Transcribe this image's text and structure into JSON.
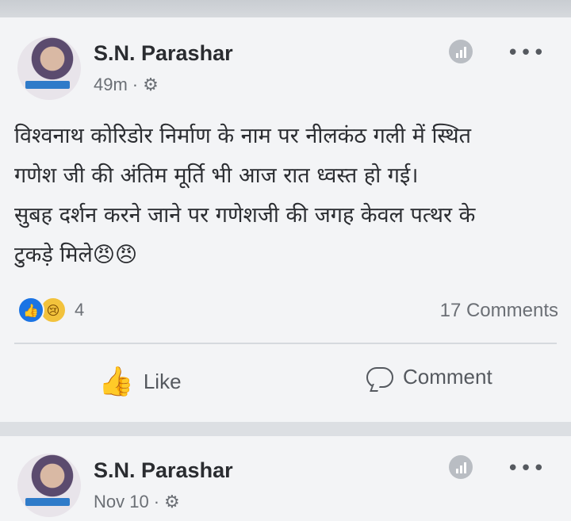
{
  "posts": [
    {
      "author": "S.N. Parashar",
      "time": "49m",
      "meta_separator": "·",
      "privacy_icon": "gear-icon",
      "text_lines": [
        "विश्वनाथ कोरिडोर निर्माण के नाम पर नीलकंठ गली में स्थित",
        "गणेश जी की अंतिम मूर्ति भी आज रात ध्वस्त हो गई।",
        "सुबह दर्शन करने जाने पर गणेशजी की जगह केवल पत्थर के",
        "टुकड़े मिले😠😠"
      ],
      "reaction_count": "4",
      "comments": "17 Comments",
      "like_label": "Like",
      "comment_label": "Comment"
    },
    {
      "author": "S.N. Parashar",
      "time": "Nov 10",
      "meta_separator": "·",
      "privacy_icon": "gear-icon"
    }
  ],
  "colors": {
    "accent": "#1b74e4",
    "card_bg": "#f3f4f6",
    "page_bg": "#dcdfe3",
    "text": "#2b2d31",
    "muted": "#6b6f75"
  }
}
